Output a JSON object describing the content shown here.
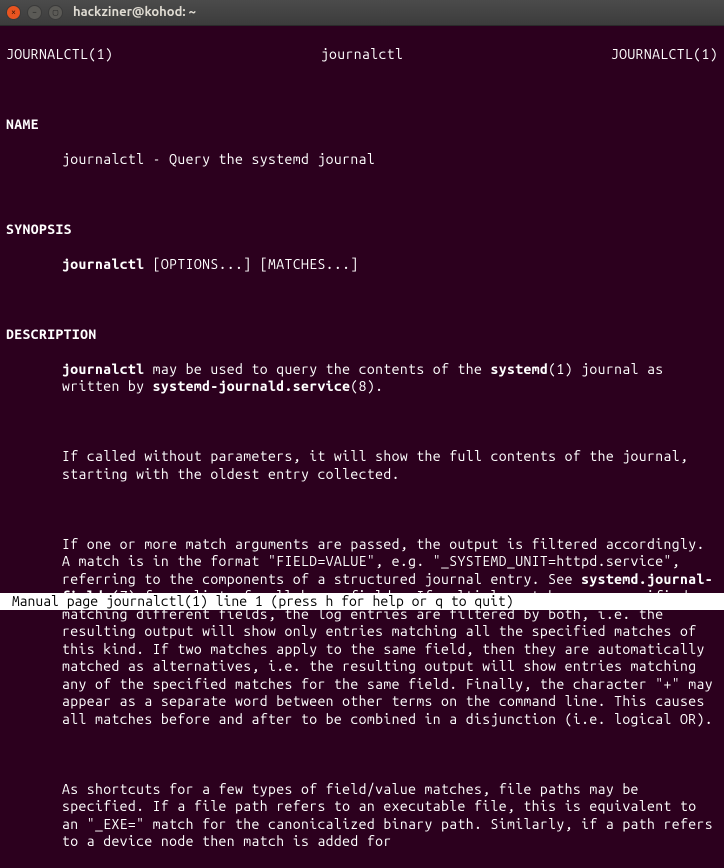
{
  "window": {
    "title": "hackziner@kohod: ~",
    "close_icon": "×",
    "min_icon": "–",
    "max_icon": "▢"
  },
  "header": {
    "left": "JOURNALCTL(1)",
    "center": "journalctl",
    "right": "JOURNALCTL(1)"
  },
  "sections": {
    "name_label": "NAME",
    "name_text": "journalctl - Query the systemd journal",
    "synopsis_label": "SYNOPSIS",
    "synopsis_cmd": "journalctl",
    "synopsis_args": " [OPTIONS...] [MATCHES...]",
    "description_label": "DESCRIPTION",
    "desc_p1_a": "journalctl",
    "desc_p1_b": " may be used to query the contents of the ",
    "desc_p1_c": "systemd",
    "desc_p1_d": "(1) journal as written by ",
    "desc_p1_e": "systemd-journald.service",
    "desc_p1_f": "(8).",
    "desc_p2": "If called without parameters, it will show the full contents of the journal, starting with the oldest entry collected.",
    "desc_p3_a": "If one or more match arguments are passed, the output is filtered accordingly. A match is in the format \"FIELD=VALUE\", e.g. \"_SYSTEMD_UNIT=httpd.service\", referring to the components of a structured journal entry. See ",
    "desc_p3_b": "systemd.journal-fields",
    "desc_p3_c": "(7) for a list of well-known fields. If multiple matches are specified matching different fields, the log entries are filtered by both, i.e. the resulting output will show only entries matching all the specified matches of this kind. If two matches apply to the same field, then they are automatically matched as alternatives, i.e. the resulting output will show entries matching any of the specified matches for the same field. Finally, the character \"+\" may appear as a separate word between other terms on the command line. This causes all matches before and after to be combined in a disjunction (i.e. logical OR).",
    "desc_p4": "As shortcuts for a few types of field/value matches, file paths may be specified. If a file path refers to an executable file, this is equivalent to an \"_EXE=\" match for the canonicalized binary path. Similarly, if a path refers to a device node then match is added for"
  },
  "status": " Manual page journalctl(1) line 1 (press h for help or q to quit)"
}
